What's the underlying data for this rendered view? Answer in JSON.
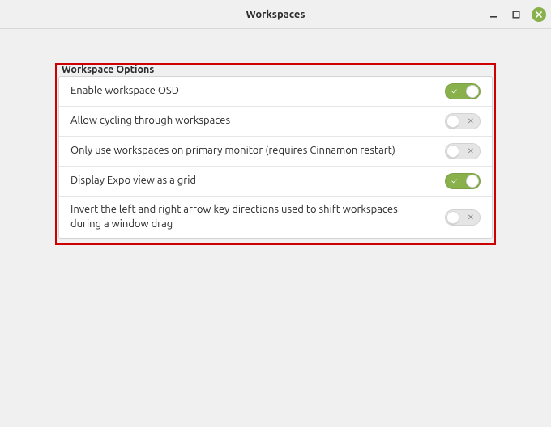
{
  "window": {
    "title": "Workspaces"
  },
  "panel": {
    "title": "Workspace Options",
    "options": [
      {
        "id": "enable-osd",
        "label": "Enable workspace OSD",
        "value": true
      },
      {
        "id": "allow-cycling",
        "label": "Allow cycling through workspaces",
        "value": false
      },
      {
        "id": "primary-only",
        "label": "Only use workspaces on primary monitor (requires Cinnamon restart)",
        "value": false
      },
      {
        "id": "expo-grid",
        "label": "Display Expo view as a grid",
        "value": true
      },
      {
        "id": "invert-arrows",
        "label": "Invert the left and right arrow key directions used to shift workspaces during a window drag",
        "value": false
      }
    ]
  },
  "icons": {
    "minimize": "minimize-icon",
    "maximize": "maximize-icon",
    "close": "close-icon",
    "check": "✓",
    "cross": "✕"
  }
}
